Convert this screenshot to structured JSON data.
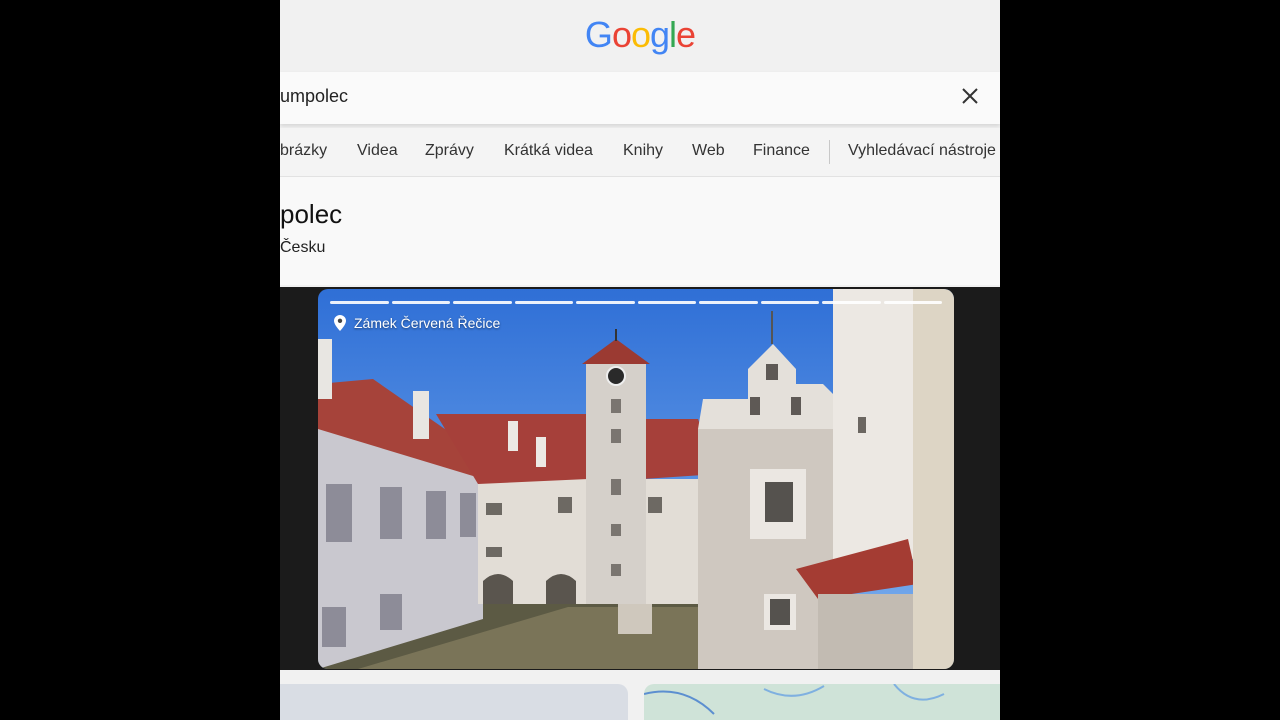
{
  "logo": {
    "letters": [
      "G",
      "o",
      "o",
      "g",
      "l",
      "e"
    ],
    "colors": [
      "#4285F4",
      "#EA4335",
      "#FBBC05",
      "#4285F4",
      "#34A853",
      "#EA4335"
    ]
  },
  "search": {
    "query": "umpolec",
    "clear_icon": "close-icon"
  },
  "tabs": [
    {
      "label": "brázky"
    },
    {
      "label": "Videa"
    },
    {
      "label": "Zprávy"
    },
    {
      "label": "Krátká videa"
    },
    {
      "label": "Knihy"
    },
    {
      "label": "Web"
    },
    {
      "label": "Finance"
    },
    {
      "label": "Vyhledávací nástroje"
    }
  ],
  "result": {
    "title": "polec",
    "subtitle": "Česku"
  },
  "story": {
    "place": "Zámek Červená Řečice",
    "place_icon": "location-pin-icon",
    "segments": 10
  }
}
